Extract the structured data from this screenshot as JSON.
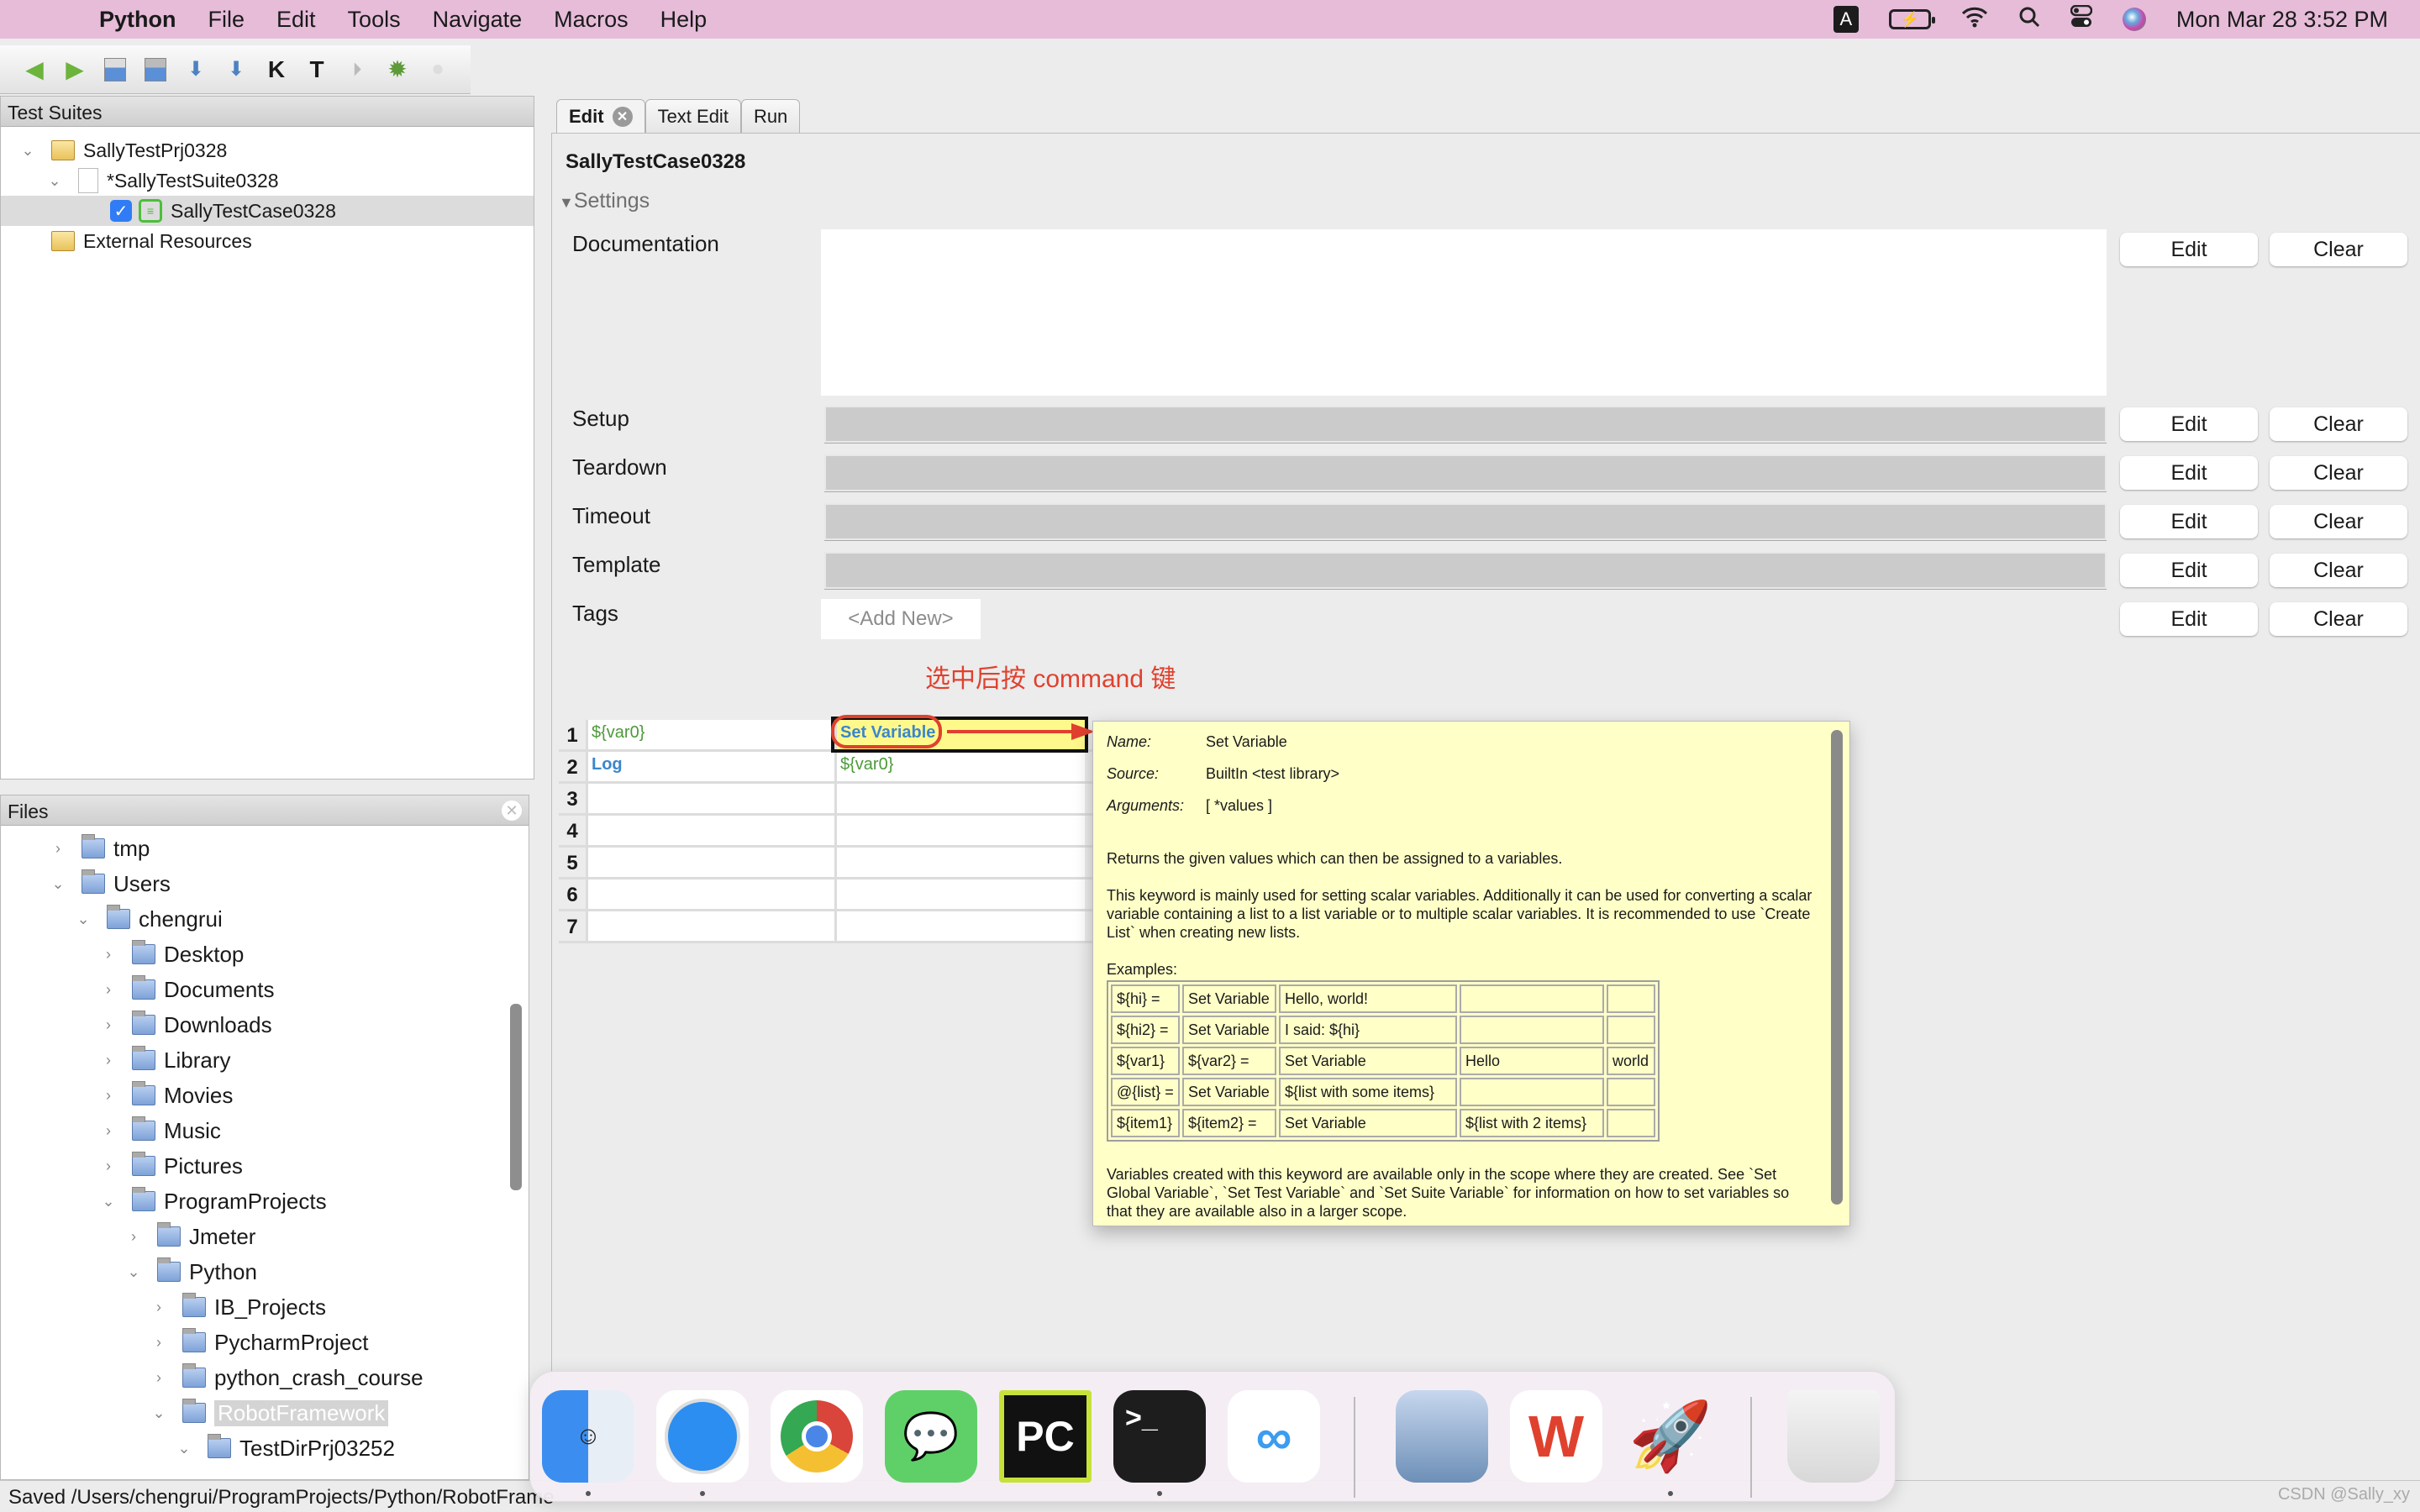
{
  "menubar": {
    "app_name": "Python",
    "items": [
      "File",
      "Edit",
      "Tools",
      "Navigate",
      "Macros",
      "Help"
    ],
    "status": {
      "input_source": "A",
      "datetime": "Mon Mar 28  3:52 PM"
    }
  },
  "toolbar": {
    "buttons": [
      "back",
      "forward",
      "open-suite",
      "open-directory",
      "save",
      "save-all",
      "search-keywords",
      "search-tests",
      "run",
      "debug",
      "stop"
    ]
  },
  "test_suites": {
    "title": "Test Suites",
    "items": [
      {
        "label": "SallyTestPrj0328",
        "icon": "project-folder-icon",
        "expanded": true
      },
      {
        "label": "*SallyTestSuite0328",
        "icon": "file-icon",
        "expanded": true
      },
      {
        "label": "SallyTestCase0328",
        "icon": "test-case-icon",
        "checked": true,
        "selected": true
      },
      {
        "label": "External Resources",
        "icon": "project-folder-icon"
      }
    ]
  },
  "files": {
    "title": "Files",
    "items": [
      {
        "label": "tmp",
        "expanded": false
      },
      {
        "label": "Users",
        "expanded": true
      },
      {
        "label": "chengrui",
        "expanded": true
      },
      {
        "label": "Desktop",
        "expanded": false
      },
      {
        "label": "Documents",
        "expanded": false
      },
      {
        "label": "Downloads",
        "expanded": false
      },
      {
        "label": "Library",
        "expanded": false
      },
      {
        "label": "Movies",
        "expanded": false
      },
      {
        "label": "Music",
        "expanded": false
      },
      {
        "label": "Pictures",
        "expanded": false
      },
      {
        "label": "ProgramProjects",
        "expanded": true
      },
      {
        "label": "Jmeter",
        "expanded": false
      },
      {
        "label": "Python",
        "expanded": true
      },
      {
        "label": "IB_Projects",
        "expanded": false
      },
      {
        "label": "PycharmProject",
        "expanded": false
      },
      {
        "label": "python_crash_course",
        "expanded": false
      },
      {
        "label": "RobotFramework",
        "expanded": true,
        "selected": true
      },
      {
        "label": "TestDirPrj03252",
        "expanded": true
      }
    ]
  },
  "tabs": [
    {
      "label": "Edit",
      "active": true,
      "closable": true
    },
    {
      "label": "Text Edit"
    },
    {
      "label": "Run"
    }
  ],
  "editor": {
    "title": "SallyTestCase0328",
    "settings_label": "Settings",
    "fields": {
      "documentation": "Documentation",
      "setup": "Setup",
      "teardown": "Teardown",
      "timeout": "Timeout",
      "template": "Template",
      "tags": "Tags"
    },
    "edit_label": "Edit",
    "clear_label": "Clear",
    "tags_placeholder": "<Add New>",
    "annotation": "选中后按 command 键",
    "grid": [
      {
        "num": "1",
        "c1": "${var0}",
        "c2": "Set Variable"
      },
      {
        "num": "2",
        "c1": "Log",
        "c2": "${var0}"
      },
      {
        "num": "3",
        "c1": "",
        "c2": ""
      },
      {
        "num": "4",
        "c1": "",
        "c2": ""
      },
      {
        "num": "5",
        "c1": "",
        "c2": ""
      },
      {
        "num": "6",
        "c1": "",
        "c2": ""
      },
      {
        "num": "7",
        "c1": "",
        "c2": ""
      }
    ]
  },
  "tooltip": {
    "name_k": "Name:",
    "name_v": "Set Variable",
    "source_k": "Source:",
    "source_v": "BuiltIn <test library>",
    "args_k": "Arguments:",
    "args_v": "[ *values ]",
    "p1": "Returns the given values which can then be assigned to a variables.",
    "p2": "This keyword is mainly used for setting scalar variables. Additionally it can be used for converting a scalar variable containing a list to a list variable or to multiple scalar variables. It is recommended to use `Create List` when creating new lists.",
    "examples_label": "Examples:",
    "examples": [
      [
        "${hi} =",
        "Set Variable",
        "Hello, world!",
        "",
        ""
      ],
      [
        "${hi2} =",
        "Set Variable",
        "I said: ${hi}",
        "",
        ""
      ],
      [
        "${var1}",
        "${var2} =",
        "Set Variable",
        "Hello",
        "world"
      ],
      [
        "@{list} =",
        "Set Variable",
        "${list with some items}",
        "",
        ""
      ],
      [
        "${item1}",
        "${item2} =",
        "Set Variable",
        "${list with 2 items}",
        ""
      ]
    ],
    "p3": "Variables created with this keyword are available only in the scope where they are created. See `Set Global Variable`, `Set Test Variable` and `Set Suite Variable` for information on how to set variables so that they are available also in a larger scope."
  },
  "statusbar": {
    "text": "Saved /Users/chengrui/ProgramProjects/Python/RobotFrame"
  },
  "watermark": "CSDN @Sally_xy",
  "dock": {
    "apps": [
      {
        "name": "Finder",
        "running": true
      },
      {
        "name": "Safari",
        "running": true
      },
      {
        "name": "Chrome"
      },
      {
        "name": "WeChat"
      },
      {
        "name": "PyCharm",
        "glyph": "PC"
      },
      {
        "name": "Terminal",
        "glyph": ">_",
        "running": true
      },
      {
        "name": "Baidu Netdisk"
      },
      {
        "name": "Preview"
      },
      {
        "name": "WPS Office",
        "glyph": "W"
      },
      {
        "name": "Python Launcher",
        "running": true
      },
      {
        "name": "Trash"
      }
    ]
  }
}
